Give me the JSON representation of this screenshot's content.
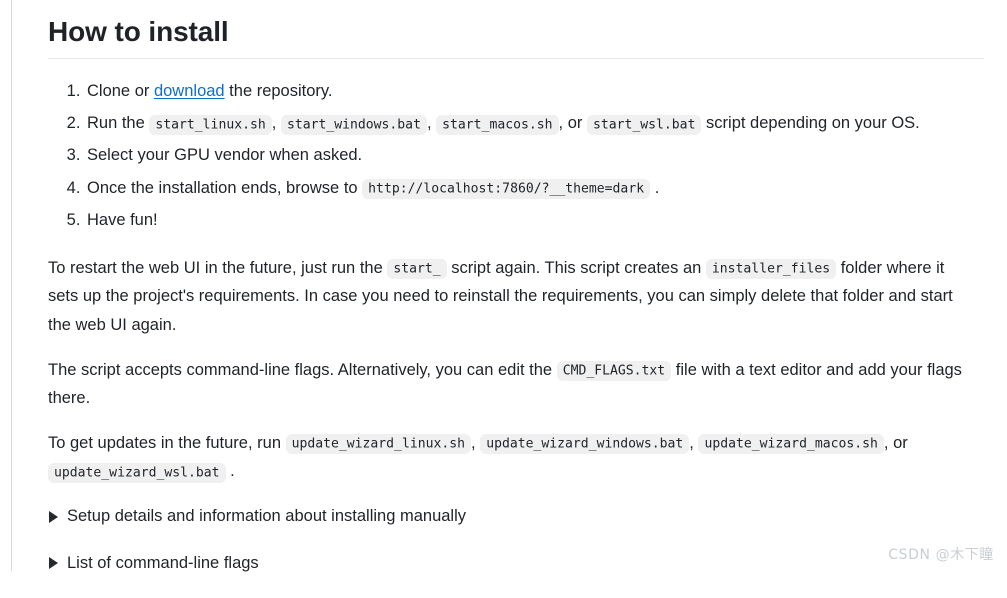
{
  "document": {
    "title": "How to install",
    "steps": [
      {
        "id": "step-clone",
        "before": "Clone or ",
        "link": "download",
        "after": " the repository."
      },
      {
        "id": "step-run",
        "before": "Run the ",
        "codes": [
          "start_linux.sh",
          "start_windows.bat",
          "start_macos.sh",
          "start_wsl.bat"
        ],
        "sep": ",",
        "or_word": "or",
        "after": "script depending on your OS."
      },
      {
        "id": "step-gpu",
        "text": "Select your GPU vendor when asked."
      },
      {
        "id": "step-browse",
        "before": "Once the installation ends, browse to ",
        "code": "http://localhost:7860/?__theme=dark",
        "after": "."
      },
      {
        "id": "step-fun",
        "text": "Have fun!"
      }
    ],
    "paragraphs": [
      {
        "id": "para-restart",
        "part1": "To restart the web UI in the future, just run the ",
        "code1": "start_",
        "part2": " script again. This script creates an ",
        "code2": "installer_files",
        "part3": " folder where it sets up the project's requirements. In case you need to reinstall the requirements, you can simply delete that folder and start the web UI again."
      },
      {
        "id": "para-flags",
        "part1": "The script accepts command-line flags. Alternatively, you can edit the ",
        "code1": "CMD_FLAGS.txt",
        "part2": " file with a text editor and add your flags there."
      },
      {
        "id": "para-updates",
        "part1": "To get updates in the future, run ",
        "codes": [
          "update_wizard_linux.sh",
          "update_wizard_windows.bat",
          "update_wizard_macos.sh",
          "update_wizard_wsl.bat"
        ],
        "sep": ",",
        "or_word": "or",
        "end": "."
      }
    ],
    "details": [
      {
        "id": "details-setup",
        "label": "Setup details and information about installing manually",
        "marker": "collapsed-triangle-icon"
      },
      {
        "id": "details-flags",
        "label": "List of command-line flags",
        "marker": "collapsed-triangle-icon"
      }
    ]
  },
  "watermark": {
    "text": "CSDN @木下瞳"
  },
  "colors": {
    "text": "#1f2328",
    "link": "#0d6ecd",
    "code_background": "#f0f0f1",
    "rule": "#e3e5e8",
    "edge_rule": "#d0d7de",
    "watermark": "#c9ced4"
  }
}
